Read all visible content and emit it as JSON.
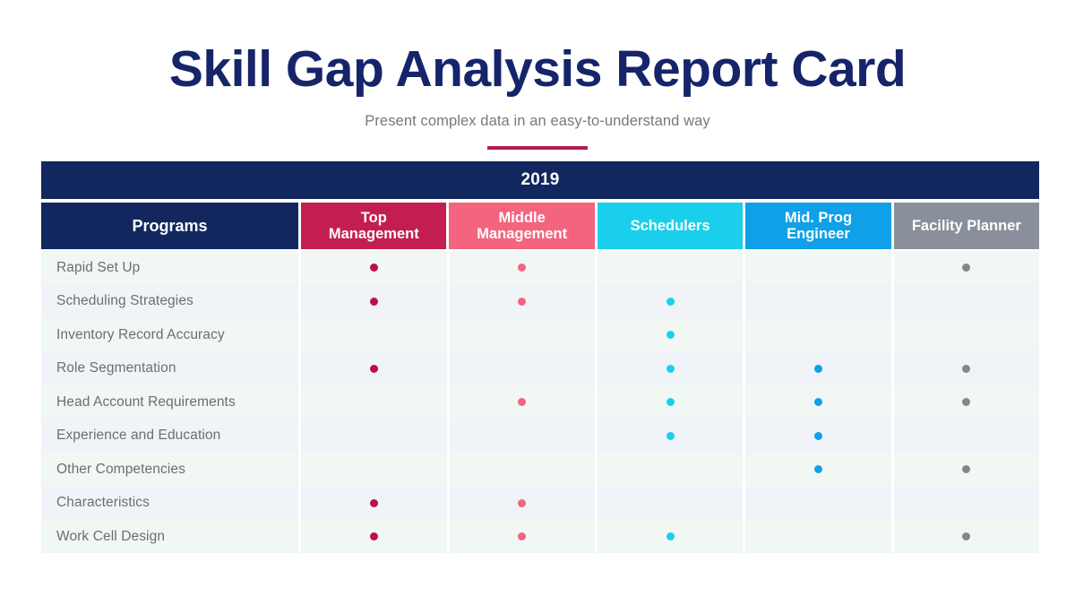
{
  "slide": {
    "title": "Skill Gap Analysis Report Card",
    "subtitle": "Present complex data in an easy-to-understand way",
    "accent_rule_color": "#B21E4B"
  },
  "table": {
    "year_label": "2019",
    "year_band_color": "#13275F",
    "columns": [
      {
        "key": "programs",
        "label": "Programs",
        "color": "#13275F",
        "dot_color": ""
      },
      {
        "key": "top_mgmt",
        "label": "Top\nManagement",
        "color": "#C41E51",
        "dot_color": "#BC1048"
      },
      {
        "key": "mid_mgmt",
        "label": "Middle\nManagement",
        "color": "#F4647E",
        "dot_color": "#F4647E"
      },
      {
        "key": "schedulers",
        "label": "Schedulers",
        "color": "#1ACFEC",
        "dot_color": "#1ACFEC"
      },
      {
        "key": "mid_prog",
        "label": "Mid. Prog\nEngineer",
        "color": "#0FA0E8",
        "dot_color": "#0FA0E8"
      },
      {
        "key": "facility",
        "label": "Facility Planner",
        "color": "#8A909B",
        "dot_color": "#81878F"
      }
    ],
    "rows": [
      {
        "label": "Rapid Set Up",
        "marks": [
          true,
          true,
          false,
          false,
          true
        ]
      },
      {
        "label": "Scheduling Strategies",
        "marks": [
          true,
          true,
          true,
          false,
          false
        ]
      },
      {
        "label": "Inventory Record Accuracy",
        "marks": [
          false,
          false,
          true,
          false,
          false
        ]
      },
      {
        "label": "Role Segmentation",
        "marks": [
          true,
          false,
          true,
          true,
          true
        ]
      },
      {
        "label": "Head Account Requirements",
        "marks": [
          false,
          true,
          true,
          true,
          true
        ]
      },
      {
        "label": "Experience and Education",
        "marks": [
          false,
          false,
          true,
          true,
          false
        ]
      },
      {
        "label": "Other Competencies",
        "marks": [
          false,
          false,
          false,
          true,
          true
        ]
      },
      {
        "label": "Characteristics",
        "marks": [
          true,
          true,
          false,
          false,
          false
        ]
      },
      {
        "label": "Work Cell Design",
        "marks": [
          true,
          true,
          true,
          false,
          true
        ]
      }
    ],
    "row_tints": [
      "#F1F7F3",
      "#F0F4F8"
    ]
  }
}
